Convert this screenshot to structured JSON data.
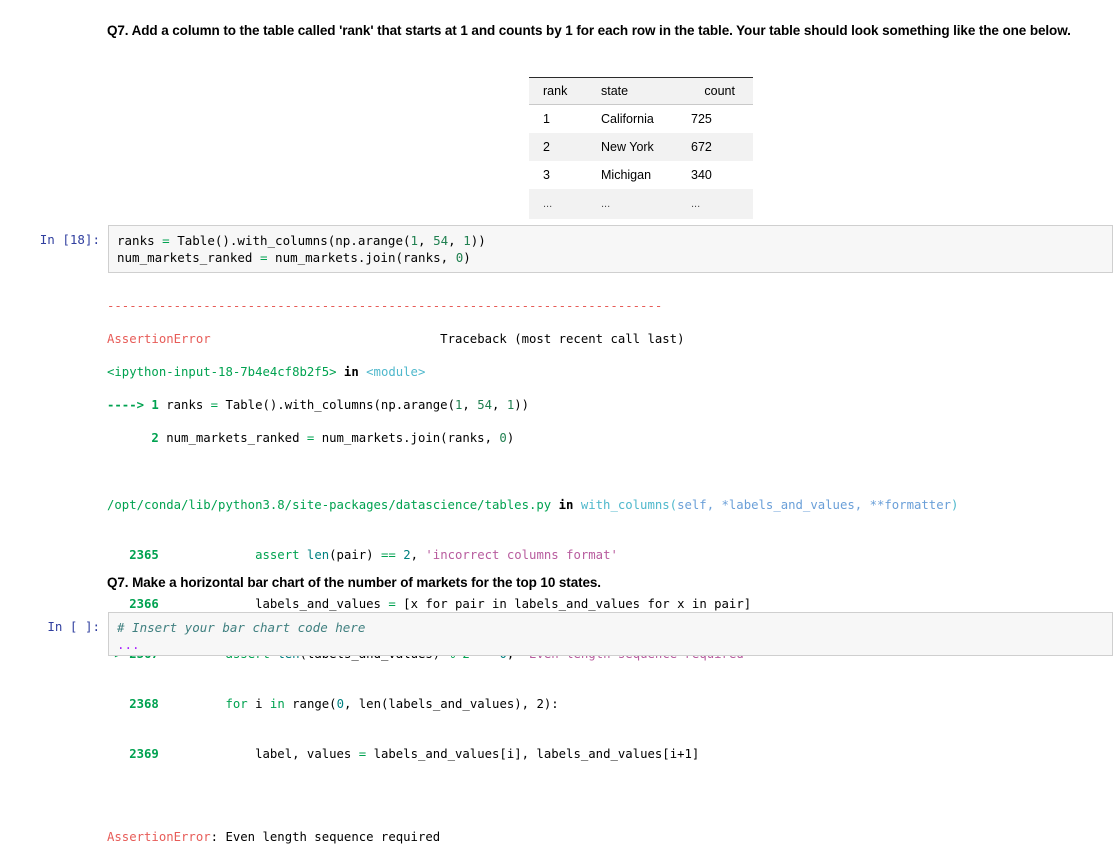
{
  "notebook": {
    "questions": {
      "top": "Q7. Add a column to the table called 'rank' that starts at 1 and counts by 1 for each row in the table. Your table should look something like the one below.",
      "bottom": "Q7. Make a horizontal bar chart of the number of markets for the top 10 states."
    },
    "result_table": {
      "headers": [
        "rank",
        "state",
        "count"
      ],
      "rows": [
        [
          "1",
          "California",
          "725"
        ],
        [
          "2",
          "New York",
          "672"
        ],
        [
          "3",
          "Michigan",
          "340"
        ],
        [
          "...",
          "...",
          "..."
        ]
      ]
    },
    "cells": [
      {
        "prompt": "In [18]:",
        "source_line1_a": "ranks ",
        "source_line1_eq": "=",
        "source_line1_b": " Table().with_columns(np.arange(",
        "source_line1_n1": "1",
        "source_line1_c": ", ",
        "source_line1_n2": "54",
        "source_line1_d": ", ",
        "source_line1_n3": "1",
        "source_line1_e": "))",
        "source_line2_a": "num_markets_ranked ",
        "source_line2_eq": "=",
        "source_line2_b": " num_markets.join(ranks, ",
        "source_line2_n": "0",
        "source_line2_c": ")"
      },
      {
        "prompt": "In [ ]:",
        "comment": "# Insert your bar chart code here",
        "ellipsis": "..."
      }
    ],
    "traceback": {
      "divider": "---------------------------------------------------------------------------",
      "error_name": "AssertionError",
      "header_right": "Traceback (most recent call last)",
      "header_gap": "                               ",
      "frame1_file": "<ipython-input-18-7b4e4cf8b2f5>",
      "frame1_in": " in ",
      "frame1_scope": "<module>",
      "arrow1": "----> ",
      "arrow1_num": "1",
      "arrow1_code_a": " ranks ",
      "arrow1_code_eq": "=",
      "arrow1_code_b": " Table().with_columns(np.arange(",
      "arrow1_n1": "1",
      "arrow1_sep1": ", ",
      "arrow1_n2": "54",
      "arrow1_sep2": ", ",
      "arrow1_n3": "1",
      "arrow1_code_end": "))",
      "line2_pad": "      ",
      "line2_num": "2",
      "line2_code_a": " num_markets_ranked ",
      "line2_code_eq": "=",
      "line2_code_b": " num_markets.join(ranks, ",
      "line2_n": "0",
      "line2_code_c": ")",
      "frame2_file": "/opt/conda/lib/python3.8/site-packages/datascience/tables.py",
      "frame2_in": " in ",
      "frame2_func": "with_columns",
      "frame2_sig_open": "(",
      "frame2_args": "self, *labels_and_values, **formatter",
      "frame2_sig_close": ")",
      "code_lines": [
        {
          "marker": "   ",
          "number": "2365",
          "indent": "             ",
          "kw": "assert",
          "mid1": " ",
          "fn": "len",
          "mid2": "(pair) ",
          "op": "==",
          "mid3": " ",
          "num": "2",
          "mid4": ", ",
          "str": "'incorrect columns format'",
          "tail": ""
        },
        {
          "marker": "   ",
          "number": "2366",
          "indent": "         ",
          "kw": "",
          "mid1": "    labels_and_values ",
          "fn": "",
          "mid2": "",
          "op": "=",
          "mid3": " [x ",
          "num": "",
          "mid4": "",
          "str": "",
          "tail": "for pair in labels_and_values for x in pair]"
        },
        {
          "marker": "-> ",
          "number": "2367",
          "indent": "         ",
          "kw": "assert",
          "mid1": " ",
          "fn": "len",
          "mid2": "(labels_and_values) ",
          "op": "% 2 ==",
          "mid3": " ",
          "num": "0",
          "mid4": ", ",
          "str": "'Even length sequence required'",
          "tail": ""
        },
        {
          "marker": "   ",
          "number": "2368",
          "indent": "         ",
          "kw": "for",
          "mid1": " i ",
          "fn": "in",
          "mid2": " range(",
          "op": "",
          "mid3": "",
          "num": "0",
          "mid4": ", ",
          "str": "",
          "tail": "len(labels_and_values), 2):"
        },
        {
          "marker": "   ",
          "number": "2369",
          "indent": "             ",
          "kw": "",
          "mid1": "label, values ",
          "fn": "",
          "mid2": "",
          "op": "=",
          "mid3": " ",
          "num": "",
          "mid4": "",
          "str": "",
          "tail": "labels_and_values[i], labels_and_values[i+1]"
        }
      ],
      "final_error_name": "AssertionError",
      "final_error_msg": ": Even length sequence required"
    }
  },
  "colors": {
    "error_red": "#e75c58",
    "prompt_blue": "#303F9F",
    "green": "#00a250",
    "teal": "#008080",
    "purple": "#aa22ff",
    "cell_bg": "#f7f7f7",
    "table_header_bg": "#f2f2f2"
  }
}
